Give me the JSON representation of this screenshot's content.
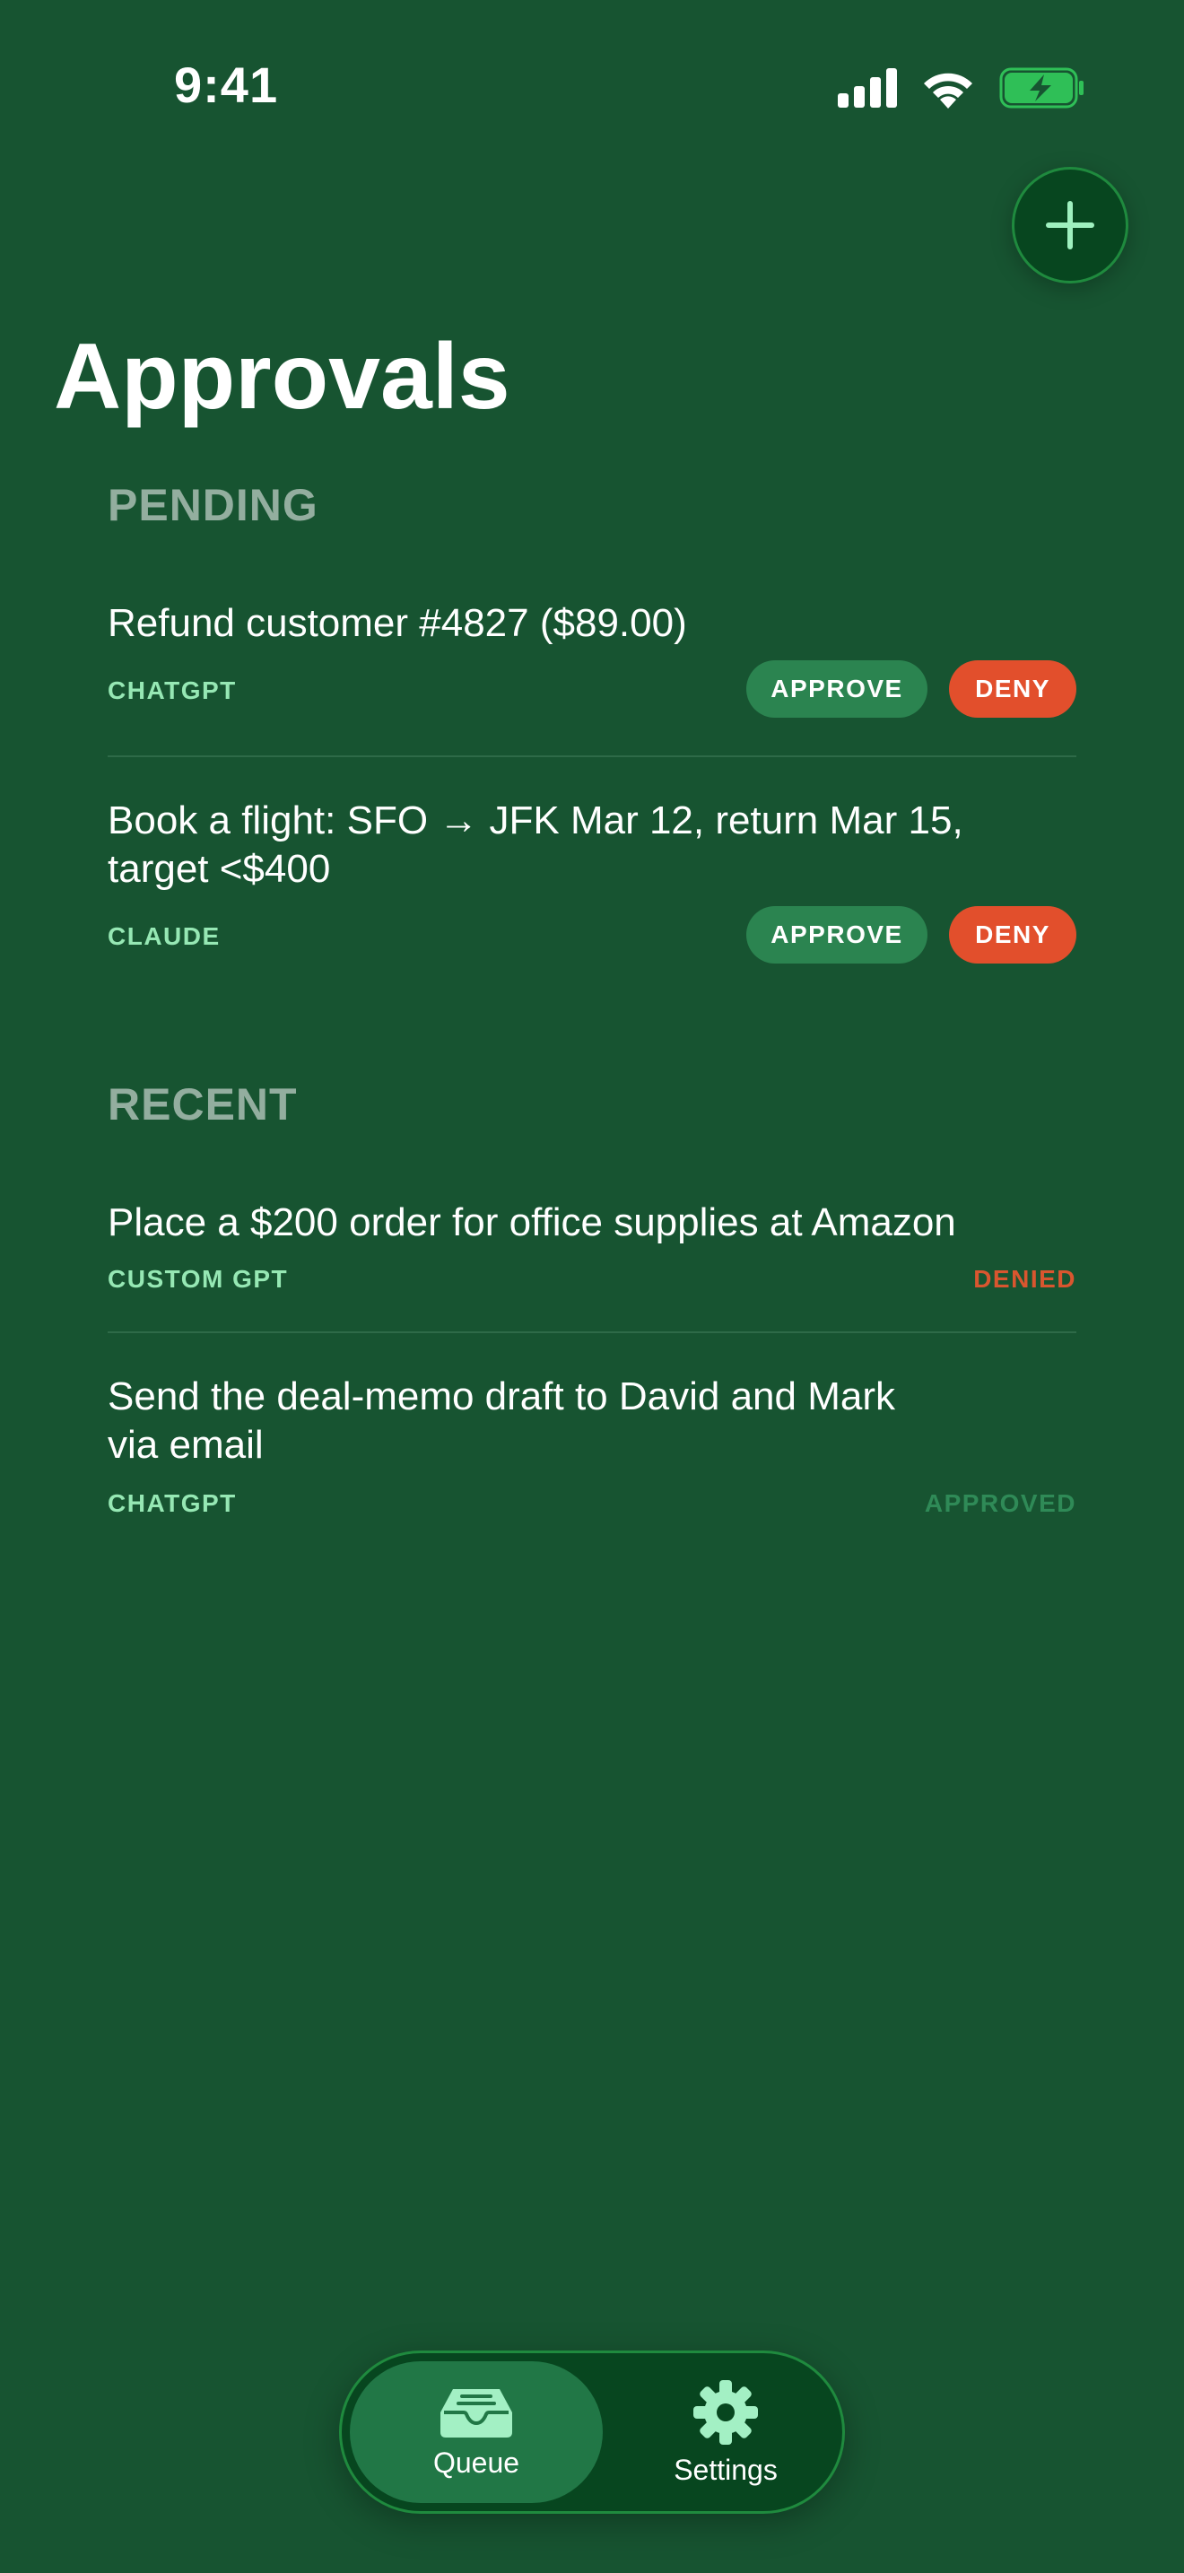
{
  "status_bar": {
    "time": "9:41",
    "icons": [
      "cellular-signal-icon",
      "wifi-icon",
      "battery-charging-icon"
    ]
  },
  "header": {
    "title": "Approvals",
    "add_icon": "plus-icon"
  },
  "pending": {
    "header": "PENDING",
    "items": [
      {
        "title": "Refund customer #4827 ($89.00)",
        "source": "CHATGPT",
        "approve_label": "APPROVE",
        "deny_label": "DENY"
      },
      {
        "title_line1": "Book a flight: SFO → JFK Mar 12, return Mar 15,",
        "title_line2": "target <$400",
        "source": "CLAUDE",
        "approve_label": "APPROVE",
        "deny_label": "DENY"
      }
    ]
  },
  "recent": {
    "header": "RECENT",
    "items": [
      {
        "title": "Place a $200 order for office supplies at Amazon",
        "source": "CUSTOM GPT",
        "status": "DENIED"
      },
      {
        "title_line1": "Send the deal-memo draft to David and Mark",
        "title_line2": "via email",
        "source": "CHATGPT",
        "status": "APPROVED"
      }
    ]
  },
  "tab_bar": {
    "tabs": [
      {
        "label": "Queue",
        "icon": "tray-icon",
        "active": true
      },
      {
        "label": "Settings",
        "icon": "gear-icon",
        "active": false
      }
    ]
  },
  "colors": {
    "background": "#175431",
    "approve": "#2b8450",
    "deny": "#e24f2c",
    "source_text": "#96e8b4",
    "denied_status": "#d9562f",
    "approved_status": "#2f8a57",
    "section_header": "#93ae9f"
  }
}
